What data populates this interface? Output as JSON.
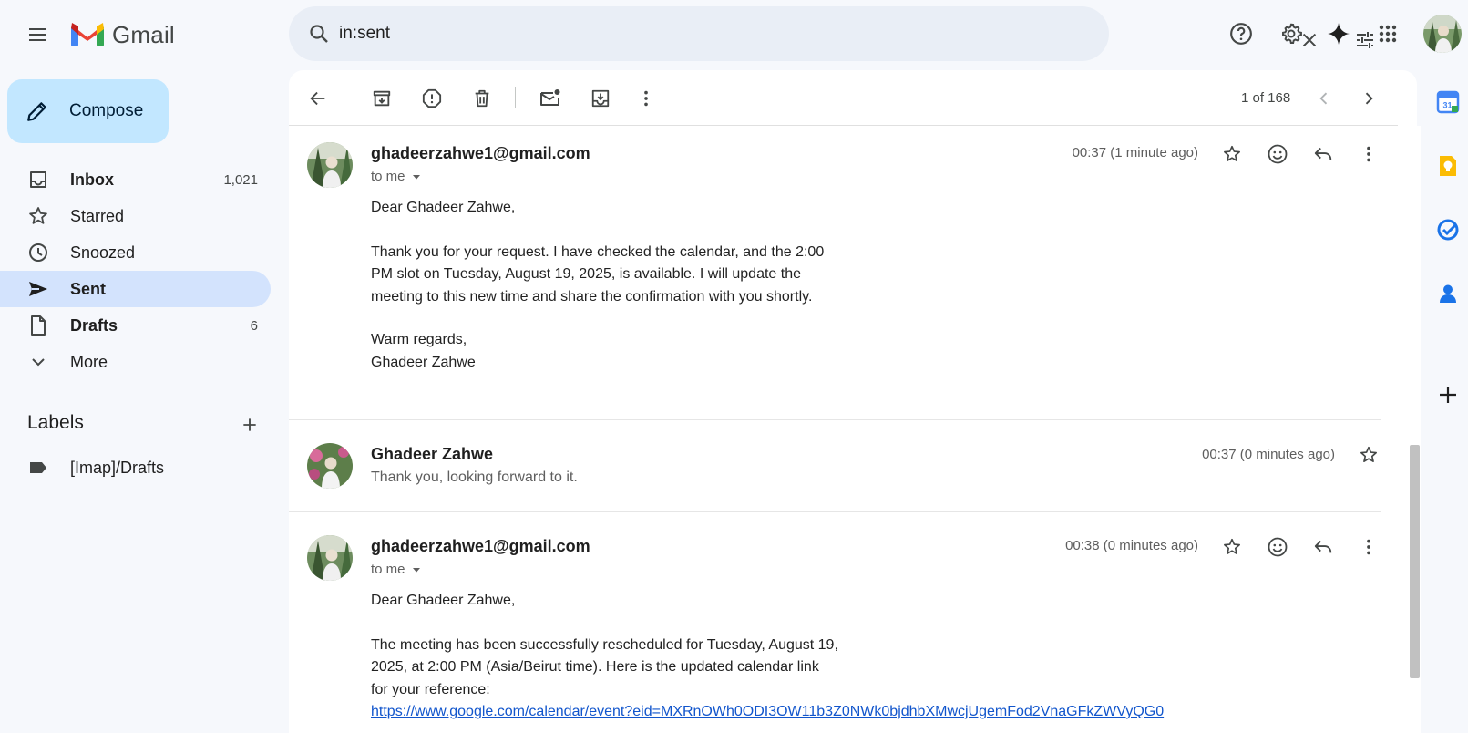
{
  "app": {
    "name": "Gmail"
  },
  "search": {
    "value": "in:sent"
  },
  "compose": {
    "label": "Compose"
  },
  "nav": [
    {
      "label": "Inbox",
      "count": "1,021",
      "icon": "inbox-icon"
    },
    {
      "label": "Starred",
      "count": "",
      "icon": "star-icon"
    },
    {
      "label": "Snoozed",
      "count": "",
      "icon": "clock-icon"
    },
    {
      "label": "Sent",
      "count": "",
      "icon": "send-icon"
    },
    {
      "label": "Drafts",
      "count": "6",
      "icon": "draft-icon"
    },
    {
      "label": "More",
      "count": "",
      "icon": "chevron-down-icon"
    }
  ],
  "labels": {
    "title": "Labels",
    "items": [
      {
        "label": "[Imap]/Drafts"
      }
    ]
  },
  "toolbar": {
    "page_count": "1 of 168"
  },
  "messages": [
    {
      "sender": "ghadeerzahwe1@gmail.com",
      "to": "to me",
      "time": "00:37 (1 minute ago)",
      "body": [
        "Dear Ghadeer Zahwe,",
        "Thank you for your request. I have checked the calendar, and the 2:00",
        "PM slot on Tuesday, August 19, 2025, is available. I will update the",
        "meeting to this new time and share the confirmation with you shortly.",
        "Warm regards,",
        "Ghadeer Zahwe"
      ]
    },
    {
      "sender": "Ghadeer Zahwe",
      "snippet": "Thank you, looking forward to it.",
      "time": "00:37 (0 minutes ago)"
    },
    {
      "sender": "ghadeerzahwe1@gmail.com",
      "to": "to me",
      "time": "00:38 (0 minutes ago)",
      "body": [
        "Dear Ghadeer Zahwe,",
        "The meeting has been successfully rescheduled for Tuesday, August 19,",
        "2025, at 2:00 PM (Asia/Beirut time). Here is the updated calendar link",
        "for your reference:"
      ],
      "link": "https://www.google.com/calendar/event?eid=MXRnOWh0ODI3OW11b3Z0NWk0bjdhbXMwcjUgemFod2VnaGFkZWVyQG0"
    }
  ],
  "side_panel": {
    "calendar_day": "31"
  },
  "colors": {
    "accent": "#0b57d0",
    "active_nav": "#d3e3fd",
    "compose": "#c2e7ff",
    "link": "#1155cc"
  }
}
